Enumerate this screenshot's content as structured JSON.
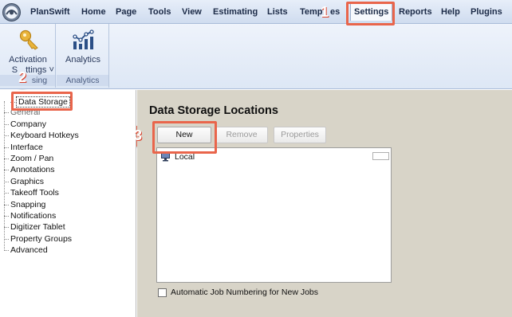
{
  "menubar": {
    "items": [
      {
        "label": "PlanSwift"
      },
      {
        "label": "Home"
      },
      {
        "label": "Page"
      },
      {
        "label": "Tools"
      },
      {
        "label": "View"
      },
      {
        "label": "Estimating"
      },
      {
        "label": "Lists"
      },
      {
        "label": "Temp"
      },
      {
        "label": "es"
      },
      {
        "label": "Settings"
      },
      {
        "label": "Reports"
      },
      {
        "label": "Help"
      },
      {
        "label": "Plugins"
      }
    ]
  },
  "ribbon": {
    "activation_label_1": "Activation",
    "activation_label_2": "S",
    "activation_label_3": "ttings",
    "analytics_label": "Analytics",
    "group1_label_partial": "sing",
    "group2_label": "Analytics"
  },
  "tree": {
    "selected": "Data Storage",
    "items": [
      "General",
      "Company",
      "Keyboard Hotkeys",
      "Interface",
      "Zoom / Pan",
      "Annotations",
      "Graphics",
      "Takeoff Tools",
      "Snapping",
      "Notifications",
      "Digitizer Tablet",
      "Property Groups",
      "Advanced"
    ]
  },
  "main": {
    "title": "Data Storage Locations",
    "buttons": {
      "new": "New",
      "remove": "Remove",
      "properties": "Properties"
    },
    "list_items": [
      "Local"
    ],
    "checkbox_label": "Automatic Job Numbering for New Jobs"
  },
  "callouts": [
    "1",
    "2",
    "3"
  ],
  "colors": {
    "callout": "#e9654b",
    "menu_text": "#1b2a47",
    "panel_bg": "#d8d4c8"
  }
}
